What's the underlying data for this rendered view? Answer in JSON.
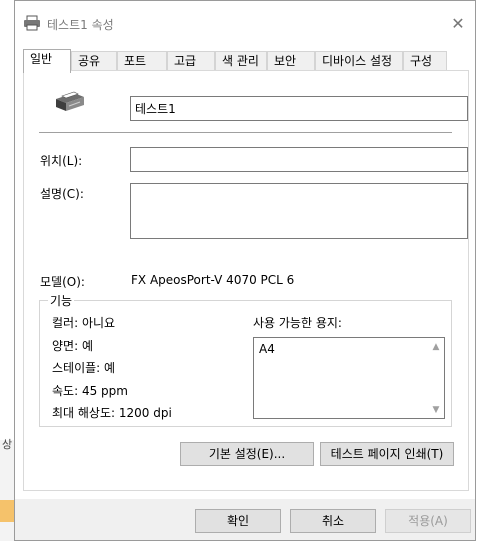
{
  "window": {
    "title": "테스트1 속성",
    "close_icon": "close-icon"
  },
  "tabs": [
    {
      "label": "일반",
      "active": true
    },
    {
      "label": "공유"
    },
    {
      "label": "포트"
    },
    {
      "label": "고급"
    },
    {
      "label": "색 관리"
    },
    {
      "label": "보안"
    },
    {
      "label": "디바이스 설정"
    },
    {
      "label": "구성"
    }
  ],
  "general": {
    "printer_name": "테스트1",
    "location_label": "위치(L):",
    "location_value": "",
    "comment_label": "설명(C):",
    "comment_value": "",
    "model_label": "모델(O):",
    "model_value": "FX ApeosPort-V 4070 PCL 6"
  },
  "features": {
    "title": "기능",
    "color": "컬러: 아니요",
    "duplex": "양면: 예",
    "staple": "스테이플: 예",
    "speed": "속도: 45 ppm",
    "resolution": "최대 해상도: 1200 dpi",
    "paper_label": "사용 가능한 용지:",
    "paper_items": [
      "A4"
    ]
  },
  "buttons": {
    "preferences": "기본 설정(E)...",
    "test_page": "테스트 페이지 인쇄(T)",
    "ok": "확인",
    "cancel": "취소",
    "apply": "적용(A)"
  },
  "background": {
    "left_text": "상"
  }
}
